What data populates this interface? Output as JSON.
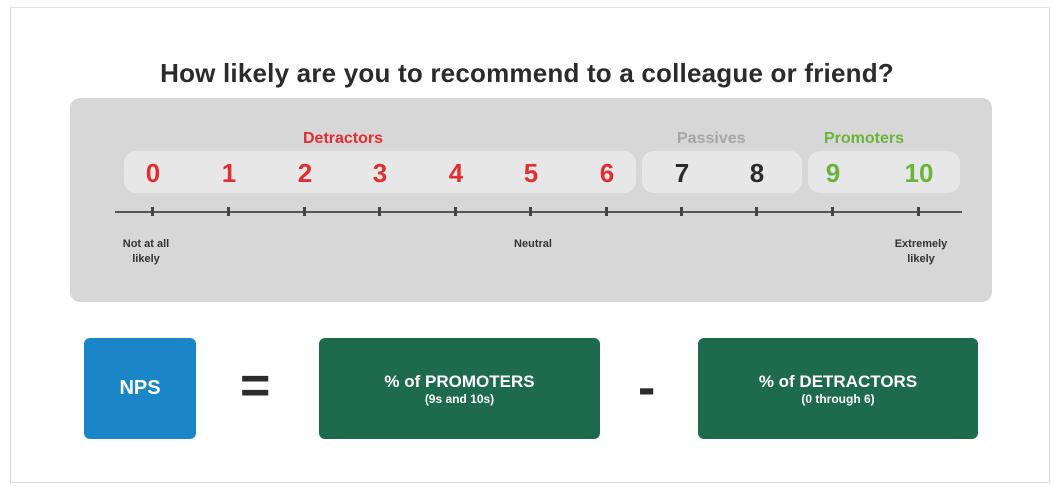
{
  "title": "How likely are you to recommend to a colleague or friend?",
  "groups": {
    "detractors": {
      "label": "Detractors",
      "color": "#e02e33"
    },
    "passives": {
      "label": "Passives",
      "color": "#a5a5a5"
    },
    "promoters": {
      "label": "Promoters",
      "color": "#6ab43b"
    }
  },
  "scale": [
    {
      "value": "0",
      "group": "detractors",
      "color": "#e02e33"
    },
    {
      "value": "1",
      "group": "detractors",
      "color": "#e02e33"
    },
    {
      "value": "2",
      "group": "detractors",
      "color": "#e02e33"
    },
    {
      "value": "3",
      "group": "detractors",
      "color": "#e02e33"
    },
    {
      "value": "4",
      "group": "detractors",
      "color": "#e02e33"
    },
    {
      "value": "5",
      "group": "detractors",
      "color": "#e02e33"
    },
    {
      "value": "6",
      "group": "detractors",
      "color": "#e02e33"
    },
    {
      "value": "7",
      "group": "passives",
      "color": "#2b2b2b"
    },
    {
      "value": "8",
      "group": "passives",
      "color": "#2b2b2b"
    },
    {
      "value": "9",
      "group": "promoters",
      "color": "#6ab43b"
    },
    {
      "value": "10",
      "group": "promoters",
      "color": "#6ab43b"
    }
  ],
  "axis": {
    "left_label_line1": "Not at all",
    "left_label_line2": "likely",
    "center_label": "Neutral",
    "right_label_line1": "Extremely",
    "right_label_line2": "likely"
  },
  "formula": {
    "nps_label": "NPS",
    "equals": "=",
    "minus": "-",
    "promoters_main": "% of PROMOTERS",
    "promoters_sub": "(9s and 10s)",
    "detractors_main": "% of DETRACTORS",
    "detractors_sub": "(0 through 6)",
    "nps_color": "#1a86c8",
    "box_color": "#1e6a4e"
  }
}
